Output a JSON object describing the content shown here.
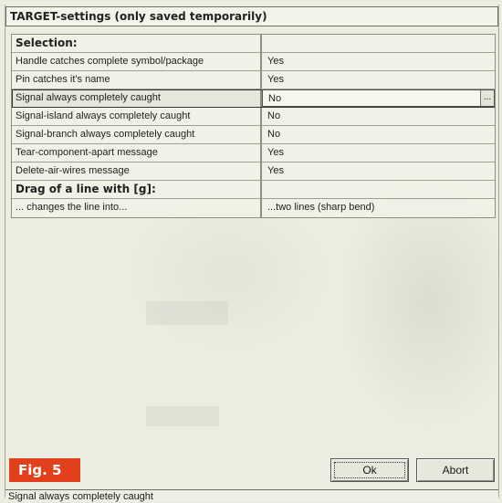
{
  "dialog": {
    "title": "TARGET-settings (only saved temporarily)"
  },
  "settings": {
    "rows": [
      {
        "label": "Selection:",
        "value": "",
        "kind": "header"
      },
      {
        "label": "Handle catches complete symbol/package",
        "value": "Yes"
      },
      {
        "label": "Pin catches it's name",
        "value": "Yes"
      },
      {
        "label": "Signal always completely caught",
        "value": "No",
        "selected": true
      },
      {
        "label": "Signal-island always completely caught",
        "value": "No"
      },
      {
        "label": "Signal-branch always completely caught",
        "value": "No"
      },
      {
        "label": "Tear-component-apart message",
        "value": "Yes"
      },
      {
        "label": "Delete-air-wires message",
        "value": "Yes"
      },
      {
        "label": "Drag of a line with [g]:",
        "value": "",
        "kind": "header"
      },
      {
        "label": "... changes the line into...",
        "value": "...two lines (sharp bend)"
      }
    ],
    "ellipsis_label": "..."
  },
  "buttons": {
    "ok_label": "Ok",
    "abort_label": "Abort"
  },
  "figure_label": "Fig. 5",
  "status_bar": {
    "text": "Signal always completely caught"
  },
  "colors": {
    "figure_badge": "#e2401c",
    "background": "#e8e9dc"
  }
}
